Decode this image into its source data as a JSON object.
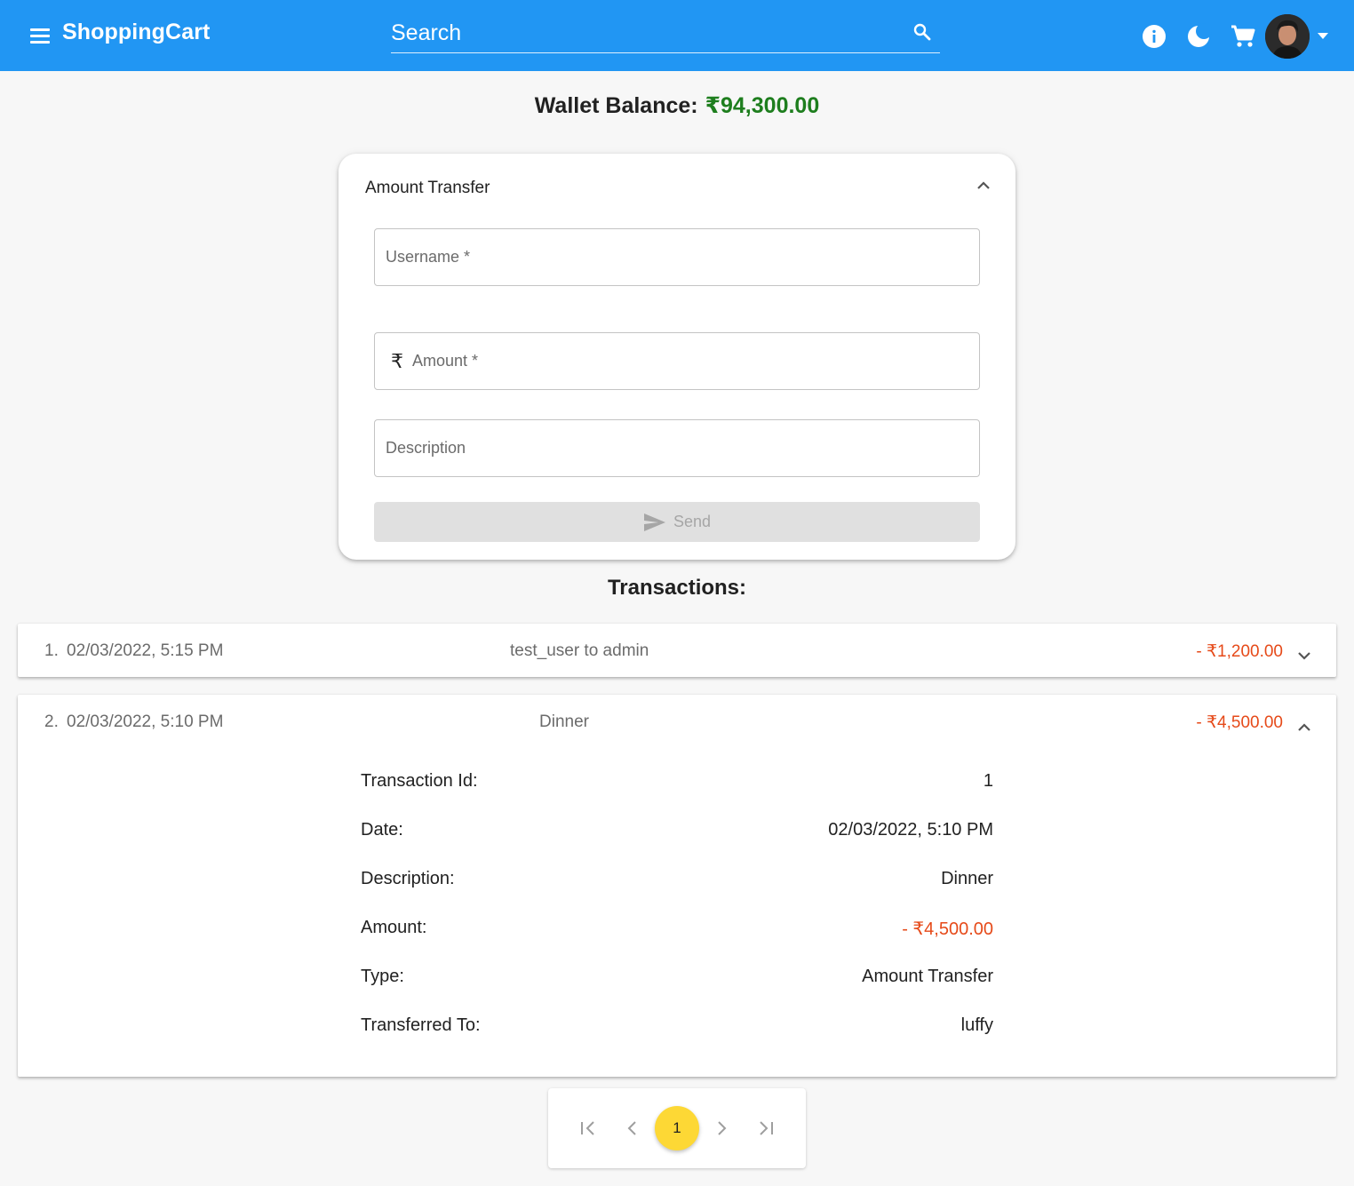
{
  "header": {
    "brand": "ShoppingCart",
    "search_placeholder": "Search",
    "icons": [
      "menu-icon",
      "search-icon",
      "info-icon",
      "dark-mode-icon",
      "cart-icon",
      "avatar",
      "dropdown-caret-icon"
    ]
  },
  "wallet": {
    "label": "Wallet Balance:",
    "balance": "₹94,300.00",
    "balance_color": "#1e7e1e"
  },
  "transfer": {
    "title": "Amount Transfer",
    "username_placeholder": "Username *",
    "amount_adornment": "₹",
    "amount_placeholder": "Amount *",
    "description_placeholder": "Description",
    "send_label": "Send"
  },
  "transactions": {
    "heading": "Transactions:",
    "items": [
      {
        "index": "1.",
        "date": "02/03/2022, 5:15 PM",
        "description": "test_user to admin",
        "amount": "- ₹1,200.00"
      },
      {
        "index": "2.",
        "date": "02/03/2022, 5:10 PM",
        "description": "Dinner",
        "amount": "- ₹4,500.00",
        "details": {
          "id_label": "Transaction Id:",
          "id_value": "1",
          "date_label": "Date:",
          "date_value": "02/03/2022, 5:10 PM",
          "desc_label": "Description:",
          "desc_value": "Dinner",
          "amount_label": "Amount:",
          "amount_value": "- ₹4,500.00",
          "type_label": "Type:",
          "type_value": "Amount Transfer",
          "to_label": "Transferred To:",
          "to_value": "luffy"
        }
      }
    ],
    "negative_color": "#e64a19"
  },
  "pagination": {
    "current_page": "1",
    "accent": "#fdd835"
  }
}
